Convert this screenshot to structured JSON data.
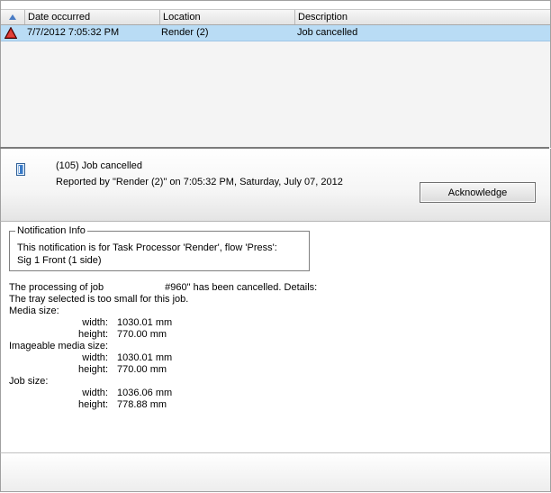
{
  "list": {
    "columns": {
      "date": "Date occurred",
      "location": "Location",
      "description": "Description"
    },
    "rows": [
      {
        "date": "7/7/2012  7:05:32 PM",
        "location": "Render (2)",
        "description": "Job cancelled",
        "icon": "warning-triangle-icon"
      }
    ]
  },
  "detail": {
    "title": "(105) Job cancelled",
    "reported": "Reported by \"Render (2)\" on 7:05:32 PM, Saturday, July 07, 2012",
    "acknowledge_label": "Acknowledge",
    "icon": "document-icon"
  },
  "info": {
    "legend": "Notification Info",
    "line1": "This notification is for Task Processor 'Render', flow 'Press':",
    "line2": "Sig 1 Front (1 side)"
  },
  "details": {
    "processing_prefix": "The processing of job",
    "processing_suffix": "#960\" has been cancelled. Details:",
    "tray_message": "The tray selected is too small for this job.",
    "media_size": {
      "label": "Media size:",
      "width_label": "width:",
      "width": "1030.01 mm",
      "height_label": "height:",
      "height": "770.00 mm"
    },
    "imageable_size": {
      "label": "Imageable media size:",
      "width_label": "width:",
      "width": "1030.01 mm",
      "height_label": "height:",
      "height": "770.00 mm"
    },
    "job_size": {
      "label": "Job size:",
      "width_label": "width:",
      "width": "1036.06 mm",
      "height_label": "height:",
      "height": "778.88 mm"
    }
  },
  "colors": {
    "selected_row": "#b9dcf5",
    "sort_arrow": "#4a7cc4",
    "warning_red": "#c0201a"
  }
}
